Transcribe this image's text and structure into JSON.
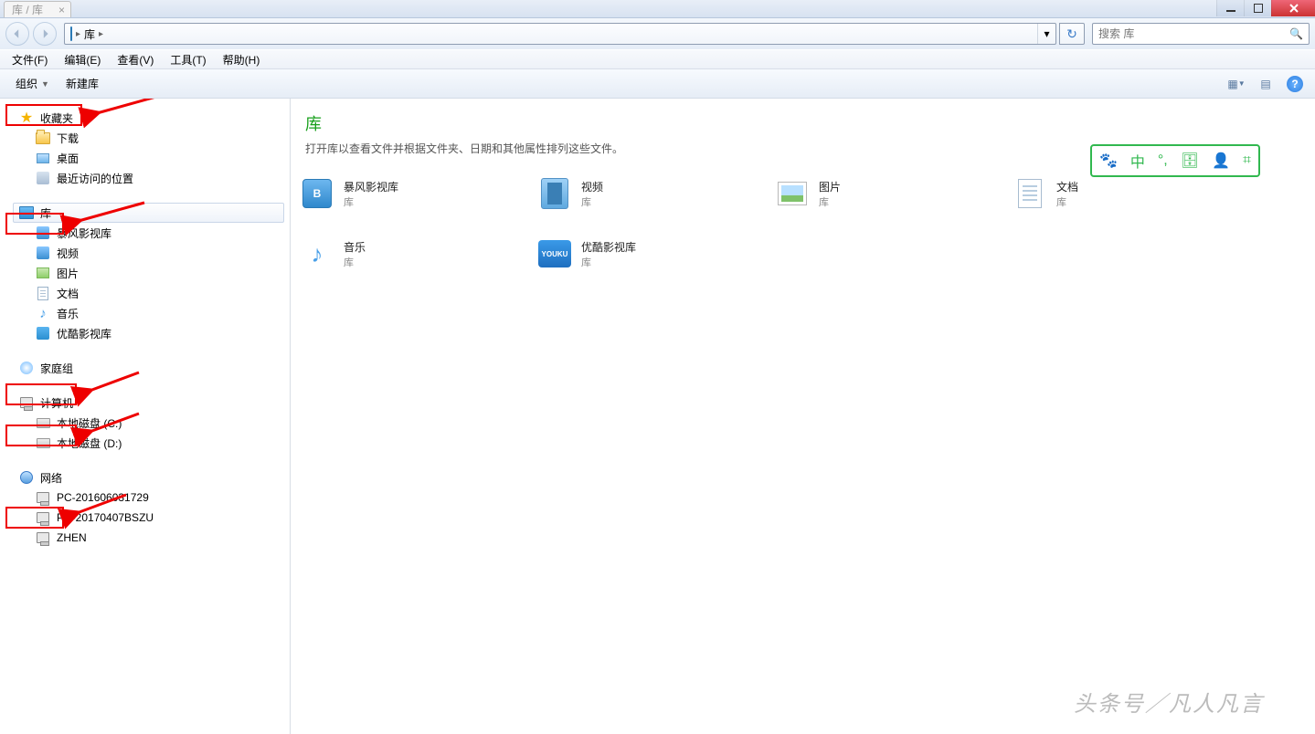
{
  "titlebar": {
    "tab_text": "库 / 库"
  },
  "address": {
    "seg1": "库",
    "dropdown_caret": "▾"
  },
  "search": {
    "placeholder": "搜索 库"
  },
  "menu": {
    "file": "文件(F)",
    "edit": "编辑(E)",
    "view": "查看(V)",
    "tools": "工具(T)",
    "help": "帮助(H)"
  },
  "cmd": {
    "organize": "组织",
    "newlib": "新建库"
  },
  "sidebar": {
    "fav": "收藏夹",
    "fav_items": {
      "downloads": "下载",
      "desktop": "桌面",
      "recent": "最近访问的位置"
    },
    "lib": "库",
    "lib_items": {
      "baofeng": "暴风影视库",
      "video": "视频",
      "pic": "图片",
      "doc": "文档",
      "music": "音乐",
      "youku": "优酷影视库"
    },
    "homegroup": "家庭组",
    "computer": "计算机",
    "computer_items": {
      "diskc": "本地磁盘 (C:)",
      "diskd": "本地磁盘 (D:)"
    },
    "network": "网络",
    "network_items": {
      "pc1": "PC-201606031729",
      "pc2": "PC-20170407BSZU",
      "pc3": "ZHEN"
    }
  },
  "content": {
    "title": "库",
    "desc": "打开库以查看文件并根据文件夹、日期和其他属性排列这些文件。",
    "sublabel": "库",
    "items": {
      "baofeng": "暴风影视库",
      "video": "视频",
      "pic": "图片",
      "doc": "文档",
      "music": "音乐",
      "youku": "优酷影视库",
      "youku_badge": "YOUKU"
    }
  },
  "floating": {
    "i1": "🐾",
    "i2": "中",
    "i3": "°,",
    "i4": "🗄",
    "i5": "👤",
    "i6": "⌗"
  },
  "watermark": "头条号／凡人凡言"
}
